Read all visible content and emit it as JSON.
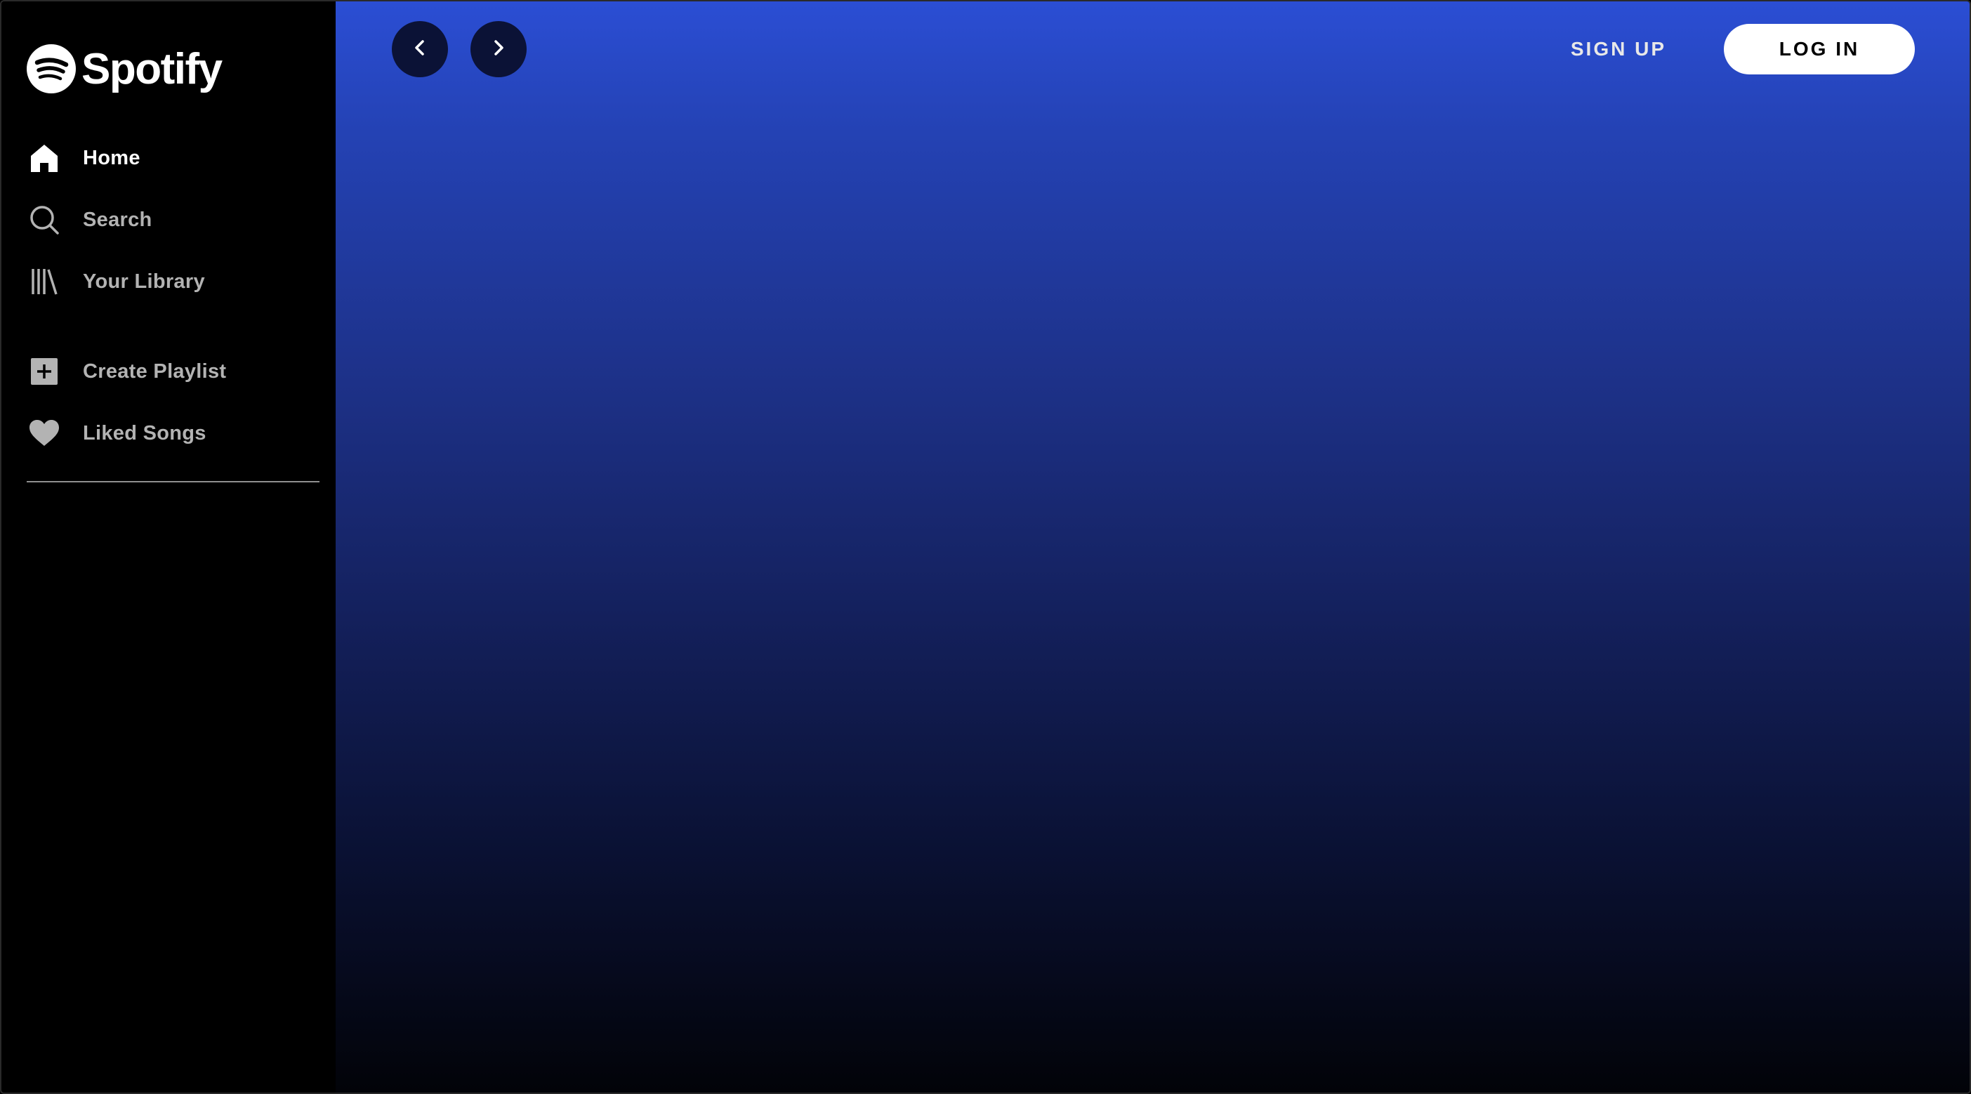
{
  "brand": {
    "name": "Spotify",
    "icon": "spotify-logo-icon"
  },
  "sidebar": {
    "nav": [
      {
        "label": "Home",
        "icon": "home-icon",
        "active": true
      },
      {
        "label": "Search",
        "icon": "search-icon",
        "active": false
      },
      {
        "label": "Your Library",
        "icon": "library-icon",
        "active": false
      }
    ],
    "actions": [
      {
        "label": "Create Playlist",
        "icon": "plus-square-icon"
      },
      {
        "label": "Liked Songs",
        "icon": "heart-icon"
      }
    ]
  },
  "topbar": {
    "back_icon": "chevron-left-icon",
    "forward_icon": "chevron-right-icon",
    "signup_label": "SIGN UP",
    "login_label": "LOG IN"
  },
  "colors": {
    "sidebar_bg": "#000000",
    "gradient_top": "#2b4ed4",
    "gradient_bottom": "#020308",
    "nav_button_bg": "#0b1236"
  }
}
